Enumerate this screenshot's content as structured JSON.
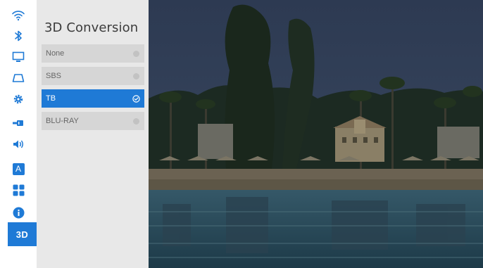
{
  "rail": {
    "items": [
      {
        "name": "wifi-icon"
      },
      {
        "name": "bluetooth-icon"
      },
      {
        "name": "display-icon"
      },
      {
        "name": "keystone-icon"
      },
      {
        "name": "settings-gear-icon"
      },
      {
        "name": "input-source-icon"
      },
      {
        "name": "volume-icon"
      },
      {
        "name": "language-icon",
        "text": "A"
      },
      {
        "name": "apps-icon"
      },
      {
        "name": "info-icon"
      },
      {
        "name": "3d-icon",
        "text": "3D"
      }
    ],
    "accent": "#1f7ad6"
  },
  "panel": {
    "title": "3D Conversion",
    "options": [
      {
        "label": "None",
        "selected": false
      },
      {
        "label": "SBS",
        "selected": false
      },
      {
        "label": "TB",
        "selected": true
      },
      {
        "label": "BLU-RAY",
        "selected": false
      }
    ]
  },
  "colors": {
    "accent": "#1f7ad6",
    "panel_bg": "#e8e8e8",
    "option_bg": "#d6d6d6"
  }
}
